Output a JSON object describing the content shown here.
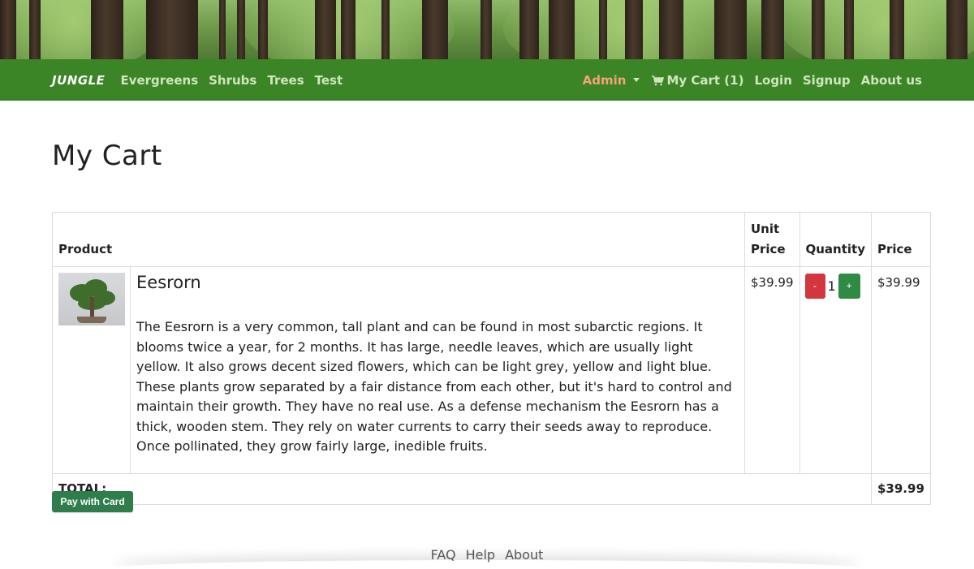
{
  "navbar": {
    "brand": "JUNGLE",
    "links": [
      "Evergreens",
      "Shrubs",
      "Trees",
      "Test"
    ],
    "admin": "Admin",
    "cart": "My Cart (1)",
    "login": "Login",
    "signup": "Signup",
    "about": "About us"
  },
  "page": {
    "title": "My Cart"
  },
  "table": {
    "headers": {
      "product": "Product",
      "unit_price": "Unit Price",
      "quantity": "Quantity",
      "price": "Price"
    },
    "items": [
      {
        "name": "Eesrorn",
        "description": "The Eesrorn is a very common, tall plant and can be found in most subarctic regions. It blooms twice a year, for 2 months. It has large, needle leaves, which are usually light yellow. It also grows decent sized flowers, which can be light grey, yellow and light blue. These plants grow separated by a fair distance from each other, but it's hard to control and maintain their growth. They have no real use. As a defense mechanism the Eesrorn has a thick, wooden stem. They rely on water currents to carry their seeds away to reproduce. Once pollinated, they grow fairly large, inedible fruits.",
        "unit_price": "$39.99",
        "quantity": "1",
        "minus_label": "-",
        "plus_label": "+",
        "price": "$39.99"
      }
    ],
    "total_label": "TOTAL:",
    "total_value": "$39.99"
  },
  "actions": {
    "pay_label": "Pay with Card"
  },
  "footer": {
    "links": [
      "FAQ",
      "Help",
      "About"
    ]
  },
  "colors": {
    "navbar": "#3b8526",
    "admin": "#f4a27a",
    "minus_button": "#d4363f",
    "plus_button": "#2f8a44",
    "pay_button": "#2e7d4b"
  }
}
